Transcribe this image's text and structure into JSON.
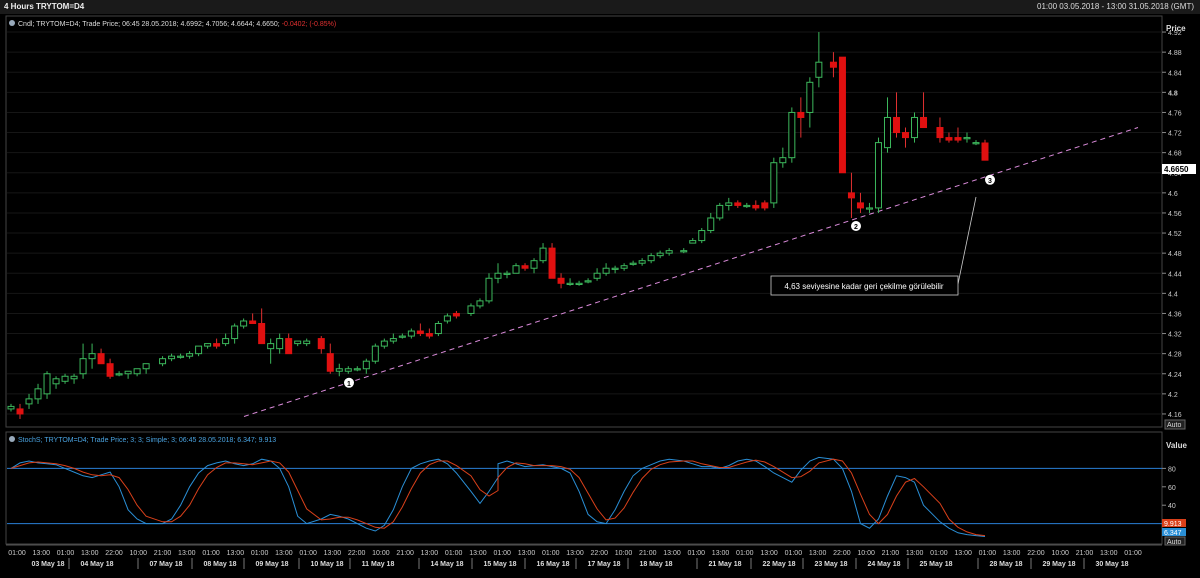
{
  "window": {
    "title": "4 Hours TRYTOM=D4",
    "range": "01:00 03.05.2018 - 13:00 31.05.2018 (GMT)"
  },
  "price_panel": {
    "header": "Cndl; TRYTOM=D4; Trade Price; 06:45 28.05.2018; 4.6992; 4.7056; 4.6644; 4.6650;",
    "change": "-0.0402; (-0.85%)",
    "axis_title": "Price",
    "last_price": "4.6650",
    "auto_label": "Auto",
    "annotation": "4,63 seviyesine kadar geri çekilme görülebilir",
    "markers": [
      "1",
      "2",
      "3"
    ]
  },
  "stoch_panel": {
    "header": "StochS; TRYTOM=D4; Trade Price;  3; 3; Simple; 3; 06:45 28.05.2018; 6.347; 9.913",
    "axis_title": "Value",
    "value_red": "9.913",
    "value_blue": "6.347",
    "auto_label": "Auto"
  },
  "colors": {
    "up": "#1f8a3a",
    "down": "#e01010",
    "trendline": "#d98ad9",
    "stoch_k": "#2a8fd6",
    "stoch_d": "#d9401a",
    "level_lines": "#2a7fd6"
  },
  "chart_data": [
    {
      "type": "candlestick",
      "title": "TRYTOM=D4 4 Hours",
      "ylabel": "Price",
      "ylim": [
        4.14,
        4.94
      ],
      "yticks": [
        4.16,
        4.2,
        4.24,
        4.28,
        4.32,
        4.36,
        4.4,
        4.44,
        4.48,
        4.52,
        4.56,
        4.6,
        4.64,
        4.68,
        4.72,
        4.76,
        4.8,
        4.84,
        4.88,
        4.92
      ],
      "ohlc": [
        [
          4.17,
          4.18,
          4.165,
          4.175
        ],
        [
          4.17,
          4.18,
          4.15,
          4.16
        ],
        [
          4.18,
          4.2,
          4.17,
          4.19
        ],
        [
          4.19,
          4.22,
          4.18,
          4.21
        ],
        [
          4.2,
          4.245,
          4.19,
          4.24
        ],
        [
          4.22,
          4.235,
          4.21,
          4.23
        ],
        [
          4.225,
          4.24,
          4.22,
          4.235
        ],
        [
          4.23,
          4.24,
          4.22,
          4.235
        ],
        [
          4.24,
          4.3,
          4.23,
          4.27
        ],
        [
          4.27,
          4.3,
          4.25,
          4.28
        ],
        [
          4.28,
          4.29,
          4.26,
          4.26
        ],
        [
          4.26,
          4.27,
          4.23,
          4.235
        ],
        [
          4.24,
          4.245,
          4.235,
          4.24
        ],
        [
          4.24,
          4.245,
          4.23,
          4.245
        ],
        [
          4.24,
          4.25,
          4.235,
          4.25
        ],
        [
          4.25,
          4.26,
          4.24,
          4.26
        ],
        [
          4.26,
          4.275,
          4.255,
          4.27
        ],
        [
          4.27,
          4.28,
          4.265,
          4.275
        ],
        [
          4.275,
          4.28,
          4.27,
          4.275
        ],
        [
          4.275,
          4.285,
          4.27,
          4.28
        ],
        [
          4.28,
          4.29,
          4.275,
          4.295
        ],
        [
          4.295,
          4.3,
          4.29,
          4.3
        ],
        [
          4.3,
          4.31,
          4.29,
          4.295
        ],
        [
          4.3,
          4.32,
          4.295,
          4.31
        ],
        [
          4.31,
          4.34,
          4.3,
          4.335
        ],
        [
          4.335,
          4.35,
          4.33,
          4.345
        ],
        [
          4.345,
          4.36,
          4.34,
          4.34
        ],
        [
          4.34,
          4.37,
          4.3,
          4.3
        ],
        [
          4.29,
          4.31,
          4.26,
          4.3
        ],
        [
          4.29,
          4.32,
          4.28,
          4.31
        ],
        [
          4.31,
          4.32,
          4.28,
          4.28
        ],
        [
          4.3,
          4.305,
          4.295,
          4.305
        ],
        [
          4.3,
          4.31,
          4.295,
          4.305
        ],
        [
          4.31,
          4.315,
          4.28,
          4.29
        ],
        [
          4.28,
          4.3,
          4.24,
          4.245
        ],
        [
          4.245,
          4.26,
          4.235,
          4.25
        ],
        [
          4.245,
          4.255,
          4.24,
          4.25
        ],
        [
          4.25,
          4.255,
          4.245,
          4.25
        ],
        [
          4.25,
          4.27,
          4.24,
          4.265
        ],
        [
          4.265,
          4.3,
          4.26,
          4.295
        ],
        [
          4.295,
          4.31,
          4.29,
          4.305
        ],
        [
          4.305,
          4.32,
          4.3,
          4.31
        ],
        [
          4.315,
          4.32,
          4.31,
          4.315
        ],
        [
          4.315,
          4.33,
          4.31,
          4.325
        ],
        [
          4.325,
          4.34,
          4.315,
          4.32
        ],
        [
          4.32,
          4.33,
          4.31,
          4.315
        ],
        [
          4.32,
          4.345,
          4.315,
          4.34
        ],
        [
          4.345,
          4.36,
          4.34,
          4.355
        ],
        [
          4.36,
          4.365,
          4.35,
          4.355
        ],
        [
          4.36,
          4.38,
          4.355,
          4.375
        ],
        [
          4.375,
          4.39,
          4.37,
          4.385
        ],
        [
          4.385,
          4.44,
          4.38,
          4.43
        ],
        [
          4.43,
          4.46,
          4.42,
          4.44
        ],
        [
          4.44,
          4.445,
          4.43,
          4.44
        ],
        [
          4.44,
          4.46,
          4.44,
          4.455
        ],
        [
          4.455,
          4.46,
          4.445,
          4.45
        ],
        [
          4.45,
          4.47,
          4.44,
          4.465
        ],
        [
          4.465,
          4.5,
          4.46,
          4.49
        ],
        [
          4.49,
          4.5,
          4.43,
          4.43
        ],
        [
          4.43,
          4.44,
          4.41,
          4.42
        ],
        [
          4.42,
          4.43,
          4.415,
          4.42
        ],
        [
          4.42,
          4.425,
          4.415,
          4.42
        ],
        [
          4.425,
          4.43,
          4.42,
          4.425
        ],
        [
          4.43,
          4.45,
          4.425,
          4.44
        ],
        [
          4.44,
          4.46,
          4.435,
          4.45
        ],
        [
          4.45,
          4.455,
          4.44,
          4.45
        ],
        [
          4.45,
          4.46,
          4.445,
          4.455
        ],
        [
          4.46,
          4.465,
          4.455,
          4.46
        ],
        [
          4.46,
          4.47,
          4.455,
          4.465
        ],
        [
          4.465,
          4.48,
          4.46,
          4.475
        ],
        [
          4.475,
          4.485,
          4.47,
          4.48
        ],
        [
          4.48,
          4.49,
          4.475,
          4.485
        ],
        [
          4.485,
          4.49,
          4.48,
          4.485
        ],
        [
          4.5,
          4.51,
          4.5,
          4.505
        ],
        [
          4.505,
          4.53,
          4.5,
          4.525
        ],
        [
          4.525,
          4.56,
          4.52,
          4.55
        ],
        [
          4.55,
          4.58,
          4.545,
          4.575
        ],
        [
          4.575,
          4.59,
          4.565,
          4.58
        ],
        [
          4.58,
          4.585,
          4.57,
          4.575
        ],
        [
          4.575,
          4.58,
          4.57,
          4.575
        ],
        [
          4.575,
          4.585,
          4.565,
          4.57
        ],
        [
          4.58,
          4.585,
          4.565,
          4.57
        ],
        [
          4.58,
          4.67,
          4.57,
          4.66
        ],
        [
          4.66,
          4.69,
          4.65,
          4.67
        ],
        [
          4.67,
          4.77,
          4.66,
          4.76
        ],
        [
          4.76,
          4.79,
          4.71,
          4.75
        ],
        [
          4.76,
          4.83,
          4.73,
          4.82
        ],
        [
          4.83,
          4.92,
          4.81,
          4.86
        ],
        [
          4.86,
          4.88,
          4.83,
          4.85
        ],
        [
          4.87,
          4.87,
          4.64,
          4.64
        ],
        [
          4.6,
          4.64,
          4.55,
          4.59
        ],
        [
          4.58,
          4.6,
          4.56,
          4.57
        ],
        [
          4.57,
          4.58,
          4.56,
          4.57
        ],
        [
          4.57,
          4.71,
          4.56,
          4.7
        ],
        [
          4.69,
          4.79,
          4.68,
          4.75
        ],
        [
          4.75,
          4.8,
          4.71,
          4.72
        ],
        [
          4.72,
          4.73,
          4.69,
          4.71
        ],
        [
          4.71,
          4.76,
          4.7,
          4.75
        ],
        [
          4.75,
          4.8,
          4.74,
          4.73
        ],
        [
          4.73,
          4.75,
          4.7,
          4.71
        ],
        [
          4.71,
          4.72,
          4.7,
          4.705
        ],
        [
          4.71,
          4.73,
          4.7,
          4.705
        ],
        [
          4.71,
          4.72,
          4.7,
          4.71
        ],
        [
          4.7,
          4.705,
          4.695,
          4.7
        ],
        [
          4.6992,
          4.7056,
          4.6644,
          4.665
        ]
      ],
      "candle_x_positions_note": "candles are placed in time slots; gaps for weekends",
      "trendline": {
        "from": {
          "slot": 0,
          "price": 4.155
        },
        "to": {
          "slot": 1,
          "price": 4.73
        }
      },
      "annotation_points": [
        {
          "label": "1",
          "price": 4.225
        },
        {
          "label": "2",
          "price": 4.535
        },
        {
          "label": "3",
          "price": 4.625
        }
      ]
    },
    {
      "type": "line",
      "title": "StochS 3 3 Simple 3",
      "ylabel": "Value",
      "ylim": [
        0,
        100
      ],
      "yticks": [
        20,
        40,
        60,
        80
      ],
      "levels": [
        80,
        20
      ],
      "series": [
        {
          "name": "%K",
          "values": [
            80,
            86,
            88,
            86,
            85,
            84,
            80,
            76,
            72,
            70,
            73,
            76,
            60,
            35,
            25,
            20,
            20,
            25,
            40,
            60,
            75,
            83,
            86,
            88,
            85,
            83,
            85,
            90,
            88,
            80,
            60,
            28,
            20,
            25,
            30,
            28,
            25,
            20,
            15,
            12,
            18,
            35,
            60,
            80,
            85,
            88,
            90,
            85,
            75,
            55,
            42,
            55,
            70,
            85,
            88,
            85,
            82,
            83,
            84,
            82,
            80,
            75,
            55,
            30,
            22,
            20,
            35,
            55,
            72,
            80,
            84,
            88,
            90,
            88,
            85,
            82,
            82,
            80,
            83,
            88,
            90,
            88,
            82,
            75,
            70,
            65,
            78,
            88,
            92,
            90,
            80,
            55,
            20,
            15,
            25,
            50,
            72,
            70,
            65,
            40,
            22,
            15,
            10,
            8,
            7,
            6
          ]
        },
        {
          "name": "%D",
          "values": [
            80,
            83,
            86,
            87,
            86,
            85,
            83,
            80,
            76,
            73,
            72,
            73,
            70,
            57,
            40,
            28,
            22,
            22,
            28,
            40,
            58,
            73,
            81,
            86,
            86,
            85,
            84,
            86,
            88,
            86,
            76,
            56,
            36,
            24,
            25,
            27,
            27,
            24,
            20,
            16,
            15,
            22,
            38,
            58,
            75,
            84,
            88,
            88,
            83,
            72,
            57,
            50,
            56,
            70,
            81,
            86,
            85,
            83,
            83,
            83,
            82,
            79,
            70,
            53,
            36,
            24,
            26,
            37,
            54,
            69,
            79,
            84,
            87,
            88,
            88,
            85,
            83,
            81,
            81,
            84,
            87,
            89,
            87,
            82,
            76,
            70,
            71,
            77,
            86,
            90,
            88,
            75,
            52,
            30,
            20,
            30,
            50,
            65,
            69,
            60,
            42,
            25,
            16,
            11,
            8,
            7
          ]
        }
      ]
    }
  ],
  "x_axis": {
    "time_ticks": [
      "01:00",
      "13:00",
      "01:00",
      "13:00",
      "22:00",
      "10:00",
      "21:00",
      "13:00",
      "01:00",
      "13:00",
      "01:00",
      "13:00",
      "01:00",
      "13:00",
      "22:00",
      "10:00",
      "21:00",
      "13:00",
      "01:00",
      "13:00",
      "01:00",
      "13:00",
      "01:00",
      "13:00",
      "22:00",
      "10:00",
      "21:00",
      "13:00",
      "01:00",
      "13:00",
      "01:00",
      "13:00",
      "01:00",
      "13:00",
      "22:00",
      "10:00",
      "21:00",
      "13:00",
      "01:00",
      "13:00",
      "01:00",
      "13:00",
      "22:00",
      "10:00",
      "21:00",
      "13:00",
      "01:00"
    ],
    "date_labels": [
      "03 May 18",
      "04 May 18",
      "07 May 18",
      "08 May 18",
      "09 May 18",
      "10 May 18",
      "11 May 18",
      "14 May 18",
      "15 May 18",
      "16 May 18",
      "17 May 18",
      "18 May 18",
      "21 May 18",
      "22 May 18",
      "23 May 18",
      "24 May 18",
      "25 May 18",
      "28 May 18",
      "29 May 18",
      "30 May 18"
    ]
  }
}
